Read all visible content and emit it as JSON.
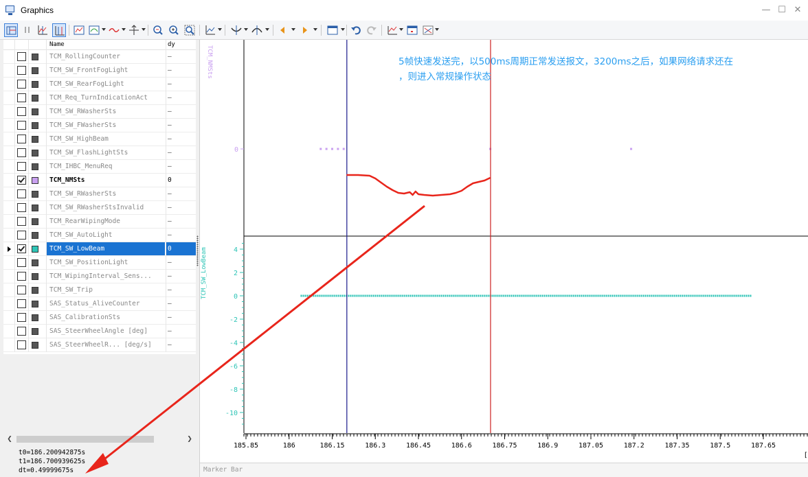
{
  "window": {
    "title": "Graphics",
    "controls": {
      "minimize": "—",
      "maximize": "☐",
      "close": "✕"
    }
  },
  "toolbar": {
    "icons": [
      "layout-icon",
      "pause-icon",
      "cursor-icon",
      "measure-icon",
      "graph-settings-icon",
      "graph-type-icon",
      "line-style-icon",
      "axis-icon",
      "zoom-in-icon",
      "zoom-out-icon",
      "zoom-fit-icon",
      "chart-icon",
      "cursor-mode-icon",
      "fit-mode-icon",
      "prev-icon",
      "next-icon",
      "view-icon",
      "undo-icon",
      "redo-icon",
      "export-icon",
      "save-icon",
      "options-icon"
    ]
  },
  "signals": {
    "header": {
      "name": "Name",
      "dy": "dy"
    },
    "rows": [
      {
        "name": "TCM_RollingCounter",
        "dy": "–",
        "checked": false,
        "color": "#555555"
      },
      {
        "name": "TCM_SW_FrontFogLight",
        "dy": "–",
        "checked": false,
        "color": "#555555"
      },
      {
        "name": "TCM_SW_RearFogLight",
        "dy": "–",
        "checked": false,
        "color": "#555555"
      },
      {
        "name": "TCM_Req_TurnIndicationAct",
        "dy": "–",
        "checked": false,
        "color": "#555555"
      },
      {
        "name": "TCM_SW_RWasherSts",
        "dy": "–",
        "checked": false,
        "color": "#555555"
      },
      {
        "name": "TCM_SW_FWasherSts",
        "dy": "–",
        "checked": false,
        "color": "#555555"
      },
      {
        "name": "TCM_SW_HighBeam",
        "dy": "–",
        "checked": false,
        "color": "#555555"
      },
      {
        "name": "TCM_SW_FlashLightSts",
        "dy": "–",
        "checked": false,
        "color": "#555555"
      },
      {
        "name": "TCM_IHBC_MenuReq",
        "dy": "–",
        "checked": false,
        "color": "#555555"
      },
      {
        "name": "TCM_NMSts",
        "dy": "0",
        "checked": true,
        "color": "#c9a0f0",
        "active": true
      },
      {
        "name": "TCM_SW_RWasherSts",
        "dy": "–",
        "checked": false,
        "color": "#555555"
      },
      {
        "name": "TCM_SW_RWasherStsInvalid",
        "dy": "–",
        "checked": false,
        "color": "#555555"
      },
      {
        "name": "TCM_RearWipingMode",
        "dy": "–",
        "checked": false,
        "color": "#555555"
      },
      {
        "name": "TCM_SW_AutoLight",
        "dy": "–",
        "checked": false,
        "color": "#555555"
      },
      {
        "name": "TCM_SW_LowBeam",
        "dy": "0",
        "checked": true,
        "color": "#2ec4b6",
        "selected": true
      },
      {
        "name": "TCM_SW_PositionLight",
        "dy": "–",
        "checked": false,
        "color": "#555555"
      },
      {
        "name": "TCM_WipingInterval_Sens...",
        "dy": "–",
        "checked": false,
        "color": "#555555"
      },
      {
        "name": "TCM_SW_Trip",
        "dy": "–",
        "checked": false,
        "color": "#555555"
      },
      {
        "name": "SAS_Status_AliveCounter",
        "dy": "–",
        "checked": false,
        "color": "#555555"
      },
      {
        "name": "SAS_CalibrationSts",
        "dy": "–",
        "checked": false,
        "color": "#555555"
      },
      {
        "name": "SAS_SteerWheelAngle [deg]",
        "dy": "–",
        "checked": false,
        "color": "#555555"
      },
      {
        "name": "SAS_SteerWheelR... [deg/s]",
        "dy": "–",
        "checked": false,
        "color": "#555555"
      }
    ]
  },
  "markers": {
    "t0": "t0=186.200942875s",
    "t1": "t1=186.700939625s",
    "dt": "dt=0.49999675s"
  },
  "annotation": {
    "line1": "5帧快速发送完，以500ms周期正常发送报文，3200ms之后，如果网络请求还在",
    "line2": "，则进入常规操作状态"
  },
  "marker_bar": {
    "label": "Marker Bar"
  },
  "chart_data": {
    "type": "line",
    "x_tick_labels": [
      "185.85",
      "186",
      "186.15",
      "186.3",
      "186.45",
      "186.6",
      "186.75",
      "186.9",
      "187.05",
      "187.2",
      "187.35",
      "187.5",
      "187.65"
    ],
    "xlim": [
      185.78,
      187.74
    ],
    "cursors": {
      "t0": 186.200942875,
      "t1": 186.700939625,
      "t0_color": "#1a1a8c",
      "t1_color": "#cc2222"
    },
    "upper_pane": {
      "signal": "TCM_NMSts",
      "ytick_labels": [
        "0"
      ],
      "color": "#c9a0f0",
      "points": [
        [
          186.11,
          0
        ],
        [
          186.13,
          0
        ],
        [
          186.15,
          0
        ],
        [
          186.17,
          0
        ],
        [
          186.19,
          0
        ],
        [
          186.7,
          0
        ],
        [
          187.19,
          0
        ]
      ]
    },
    "lower_pane": {
      "signal": "TCM_SW_LowBeam",
      "ytick_labels": [
        "4",
        "2",
        "0",
        "-2",
        "-4",
        "-6",
        "-8",
        "-10"
      ],
      "ylim": [
        -11,
        5
      ],
      "color": "#2ec4b6",
      "constant_value": 0,
      "x_range": [
        186.04,
        187.61
      ]
    },
    "annotation_overlay": {
      "color": "#e8251b",
      "curve_x": [
        186.2,
        186.24,
        186.28,
        186.3,
        186.32,
        186.34,
        186.36,
        186.38,
        186.4,
        186.42,
        186.43,
        186.44,
        186.45,
        186.47,
        186.5,
        186.53,
        186.56,
        186.58,
        186.6,
        186.62,
        186.64,
        186.66,
        186.68,
        186.7
      ],
      "curve_y": [
        255,
        255,
        256,
        260,
        266,
        272,
        277,
        281,
        282,
        280,
        284,
        279,
        283,
        284,
        285,
        284,
        283,
        281,
        278,
        272,
        267,
        265,
        263,
        259
      ]
    }
  }
}
